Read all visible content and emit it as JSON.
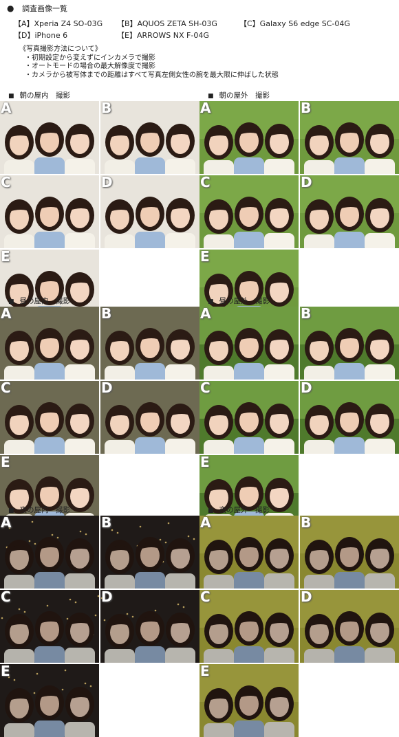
{
  "header": {
    "bullet": "●",
    "title": "調査画像一覧"
  },
  "devices": [
    "【A】Xperia Z4 SO-03G",
    "【B】AQUOS ZETA SH-03G",
    "【C】Galaxy S6 edge SC-04G",
    "【D】iPhone 6",
    "【E】ARROWS NX F-04G"
  ],
  "notes": {
    "heading": "《写真撮影方法について》",
    "items": [
      "・初期設定から変えずにインカメラで撮影",
      "・オートモードの場合の最大解像度で撮影",
      "・カメラから被写体までの距離はすべて写真左側女性の腕を最大限に伸ばした状態"
    ]
  },
  "section_marker": "■",
  "sections": [
    {
      "title": "朝の屋内　撮影",
      "scene": "indoor-morning",
      "letters": [
        "A",
        "B",
        "C",
        "D",
        "E"
      ]
    },
    {
      "title": "朝の屋外　撮影",
      "scene": "outdoor-morning",
      "letters": [
        "A",
        "B",
        "C",
        "D",
        "E"
      ]
    },
    {
      "title": "昼の屋内　撮影",
      "scene": "indoor-noon",
      "letters": [
        "A",
        "B",
        "C",
        "D",
        "E"
      ]
    },
    {
      "title": "昼の屋外　撮影",
      "scene": "outdoor-noon",
      "letters": [
        "A",
        "B",
        "C",
        "D",
        "E"
      ]
    },
    {
      "title": "夜の屋内　撮影",
      "scene": "indoor-night",
      "letters": [
        "A",
        "B",
        "C",
        "D",
        "E"
      ]
    },
    {
      "title": "夜の屋外　撮影",
      "scene": "outdoor-night",
      "letters": [
        "A",
        "B",
        "C",
        "D",
        "E"
      ]
    }
  ],
  "colors": {
    "indoor-morning": "#e8e4dc",
    "outdoor-morning": "#6f9a3e",
    "indoor-noon": "#6d6a52",
    "outdoor-noon": "#4f7a2c",
    "indoor-night": "#2a2320",
    "outdoor-night": "#b8b640"
  }
}
